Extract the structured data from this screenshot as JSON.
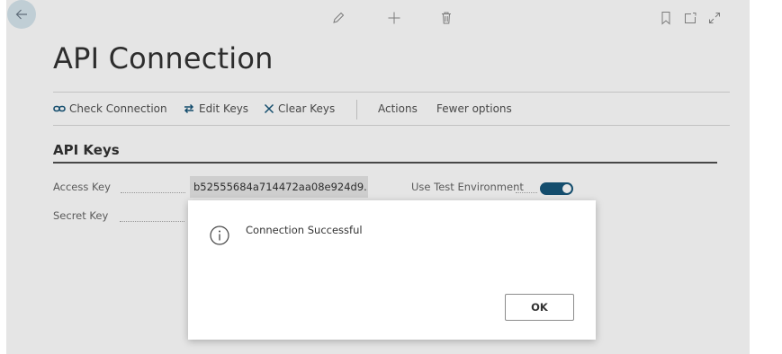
{
  "page": {
    "title": "API Connection"
  },
  "actions": {
    "check_connection": "Check Connection",
    "edit_keys": "Edit Keys",
    "clear_keys": "Clear Keys",
    "actions": "Actions",
    "fewer_options": "Fewer options"
  },
  "section": {
    "title": "API Keys"
  },
  "fields": {
    "access_key": {
      "label": "Access Key",
      "value": "b52555684a714472aa08e924d9..."
    },
    "secret_key": {
      "label": "Secret Key"
    },
    "use_test_environment": {
      "label": "Use Test Environment",
      "enabled": true
    }
  },
  "dialog": {
    "message": "Connection Successful",
    "ok_label": "OK"
  },
  "icons": {
    "back": "arrow-left-icon",
    "edit": "pencil-icon",
    "new": "plus-icon",
    "delete": "trash-icon",
    "bookmark": "bookmark-icon",
    "open_new_window": "open-new-window-icon",
    "expand": "expand-icon",
    "check_connection": "link-icon",
    "edit_keys": "swap-icon",
    "clear_keys": "x-icon",
    "info": "info-icon"
  },
  "colors": {
    "accent": "#17567a",
    "back_button_bg": "#d6e6ee"
  }
}
